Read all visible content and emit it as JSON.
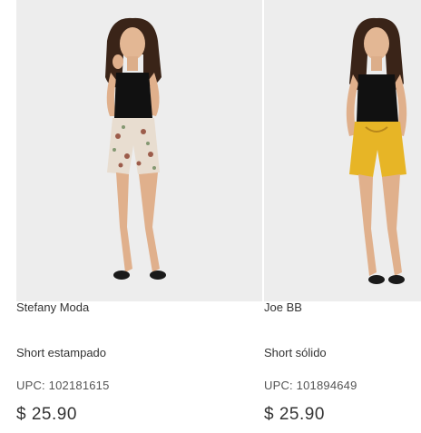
{
  "products": [
    {
      "brand": "Stefany Moda",
      "name": "Short estampado",
      "upc": "UPC: 102181615",
      "price": "$ 25.90",
      "shorts_color": "#e8ddd0",
      "shorts_pattern": "floral",
      "top_color": "#111111"
    },
    {
      "brand": "Joe BB",
      "name": "Short sólido",
      "upc": "UPC: 101894649",
      "price": "$ 25.90",
      "shorts_color": "#e7b526",
      "shorts_pattern": "solid",
      "top_color": "#111111"
    }
  ]
}
